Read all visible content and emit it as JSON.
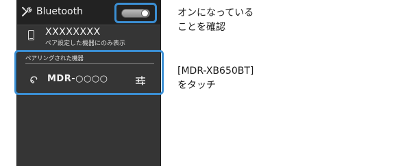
{
  "screen": {
    "title": "Bluetooth",
    "toggle_state": "on",
    "this_device": {
      "name": "XXXXXXXX",
      "subtitle": "ペア設定した機器にのみ表示"
    },
    "paired_section": {
      "header": "ペアリングされた機器",
      "device_prefix": "MDR-",
      "device_suffix": "○○○○"
    },
    "icons": {
      "title": "wrench-icon",
      "device": "smartphone-icon",
      "paired": "headphone-icon",
      "settings": "settings-sliders-icon"
    },
    "colors": {
      "highlight": "#3b8fd4",
      "background": "#353535",
      "titlebar": "#222222"
    }
  },
  "annotations": {
    "toggle_line1": "オンになっている",
    "toggle_line2": "ことを確認",
    "device_line1": "[MDR-XB650BT]",
    "device_line2": "をタッチ"
  }
}
